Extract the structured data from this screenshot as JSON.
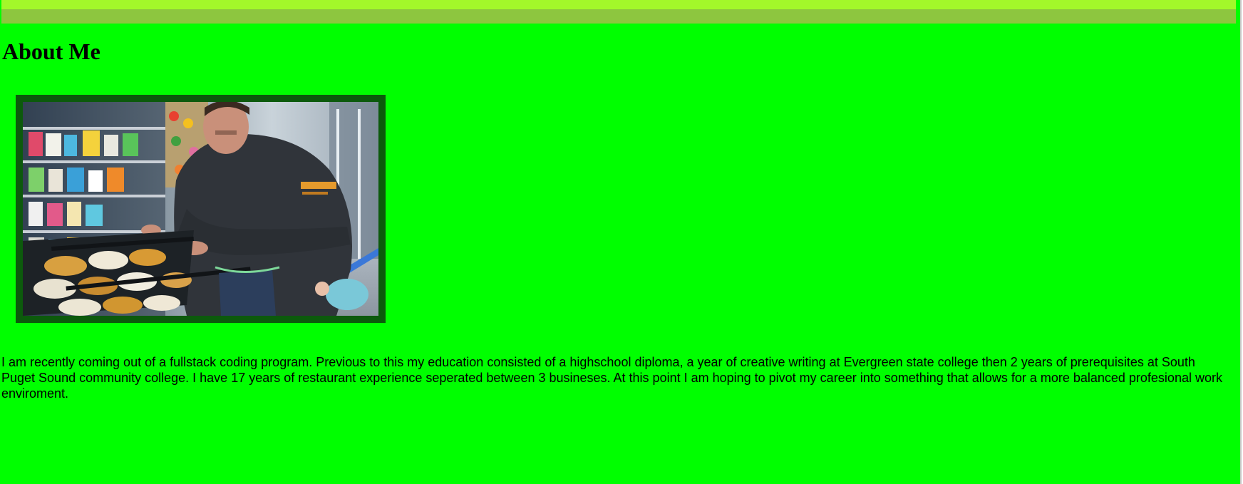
{
  "colors": {
    "page_background": "#00ff00",
    "top_bar": "#8dc63f",
    "top_bar_stripe": "#a3f82a",
    "photo_frame": "#0c5a0c"
  },
  "about": {
    "heading": "About Me",
    "photo_icon": "profile-photo",
    "bio": "I am recently coming out of a fullstack coding program. Previous to this my education consisted of a highschool diploma, a year of creative writing at Evergreen state college then 2 years of prerequisites at South Puget Sound community college. I have 17 years of restaurant experience seperated between 3 busineses. At this point I am hoping to pivot my career into something that allows for a more balanced profesional work enviroment."
  }
}
